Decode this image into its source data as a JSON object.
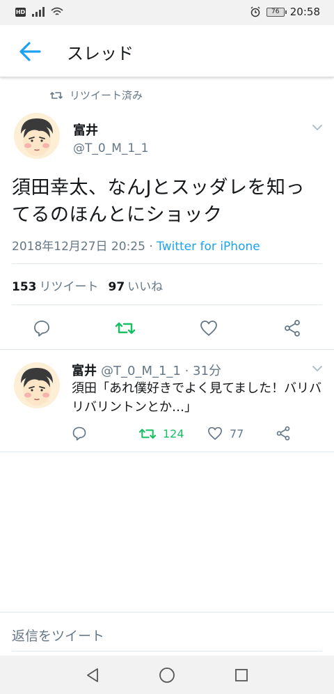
{
  "status_bar": {
    "network_badge": "HD",
    "battery": "76",
    "time": "20:58",
    "icons": [
      "hd-badge",
      "signal-icon",
      "wifi-icon",
      "alarm-icon",
      "battery-icon"
    ]
  },
  "header": {
    "title": "スレッド",
    "back_icon": "arrow-left-icon",
    "accent_color": "#1da1f2"
  },
  "tweet": {
    "retweet_label": "リツイート済み",
    "author_name": "富井",
    "author_handle": "@T_0_M_1_1",
    "text": "須田幸太、なんJとスッダレを知ってるのほんとにショック",
    "timestamp": "2018年12月27日 20:25",
    "separator": " · ",
    "source": "Twitter for iPhone",
    "retweet_count": "153",
    "retweet_label_stat": "リツイート",
    "like_count": "97",
    "like_label_stat": "いいね",
    "retweeted": true,
    "retweet_color": "#17bf63"
  },
  "reply": {
    "author_name": "富井",
    "author_handle": "@T_0_M_1_1",
    "time_ago": " · 31分",
    "text": "須田「あれ僕好きでよく見てました！バリバリバリントンとか…」",
    "retweet_count": "124",
    "like_count": "77"
  },
  "compose": {
    "placeholder": "返信をツイート"
  },
  "nav_bar": {
    "icons": [
      "nav-back-icon",
      "nav-home-icon",
      "nav-recents-icon"
    ]
  }
}
